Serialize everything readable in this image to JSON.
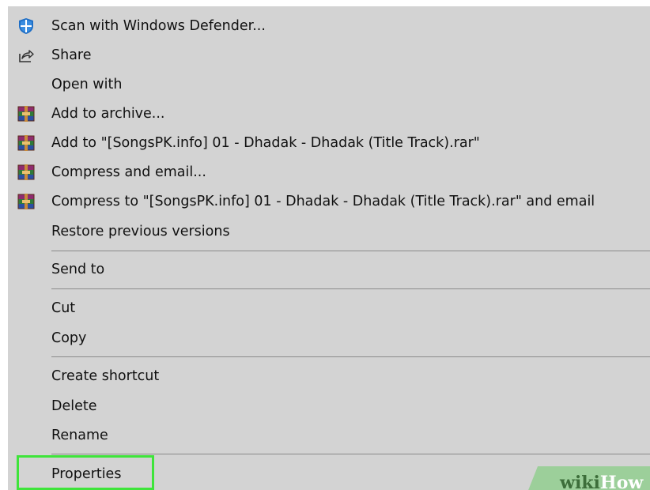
{
  "menu": {
    "items": [
      {
        "label": "Scan with Windows Defender...",
        "icon": "windows-defender-shield-icon"
      },
      {
        "label": "Share",
        "icon": "share-icon"
      },
      {
        "label": "Open with"
      },
      {
        "label": "Add to archive...",
        "icon": "winrar-archive-icon"
      },
      {
        "label": "Add to \"[SongsPK.info] 01 - Dhadak - Dhadak (Title Track).rar\"",
        "icon": "winrar-archive-icon"
      },
      {
        "label": "Compress and email...",
        "icon": "winrar-archive-icon"
      },
      {
        "label": "Compress to \"[SongsPK.info] 01 - Dhadak - Dhadak (Title Track).rar\" and email",
        "icon": "winrar-archive-icon"
      },
      {
        "label": "Restore previous versions"
      },
      {
        "label": "Send to"
      },
      {
        "label": "Cut"
      },
      {
        "label": "Copy"
      },
      {
        "label": "Create shortcut"
      },
      {
        "label": "Delete"
      },
      {
        "label": "Rename"
      },
      {
        "label": "Properties"
      }
    ]
  },
  "watermark": {
    "wiki": "wiki",
    "how": "How"
  },
  "colors": {
    "menu_background": "#d3d3d3",
    "separator": "#8a8a8a",
    "highlight_border": "#3ee43a",
    "text": "#111111"
  }
}
